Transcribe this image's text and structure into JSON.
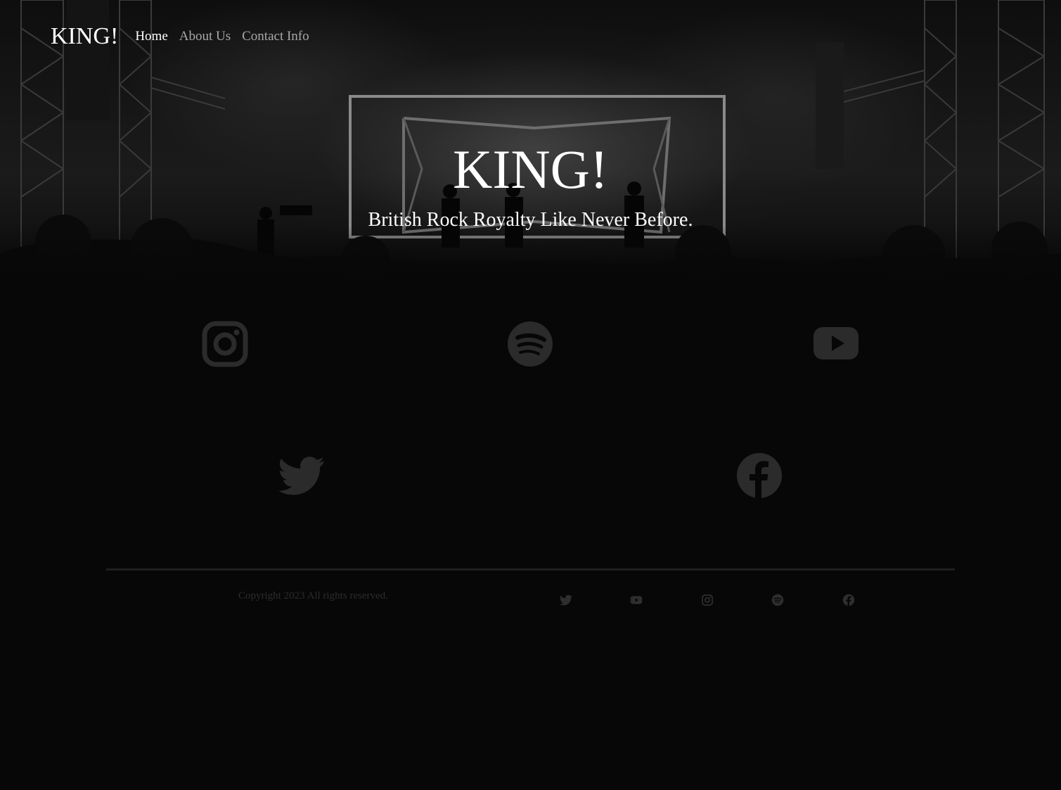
{
  "nav": {
    "brand": "KING!",
    "links": [
      {
        "label": "Home",
        "active": true
      },
      {
        "label": "About Us",
        "active": false
      },
      {
        "label": "Contact Info",
        "active": false
      }
    ]
  },
  "hero": {
    "title": "KING!",
    "subtitle": "British Rock Royalty Like Never Before."
  },
  "social_icons": [
    "instagram-icon",
    "spotify-icon",
    "youtube-icon",
    "twitter-icon",
    "facebook-icon"
  ],
  "footer": {
    "copyright": "Copyright 2023 All rights reserved.",
    "icons": [
      "twitter-icon",
      "youtube-icon",
      "instagram-icon",
      "spotify-icon",
      "facebook-icon"
    ]
  },
  "colors": {
    "background": "#070707",
    "text": "#ffffff",
    "nav_inactive": "#a8a8a8",
    "icon": "#2b2b2b"
  }
}
